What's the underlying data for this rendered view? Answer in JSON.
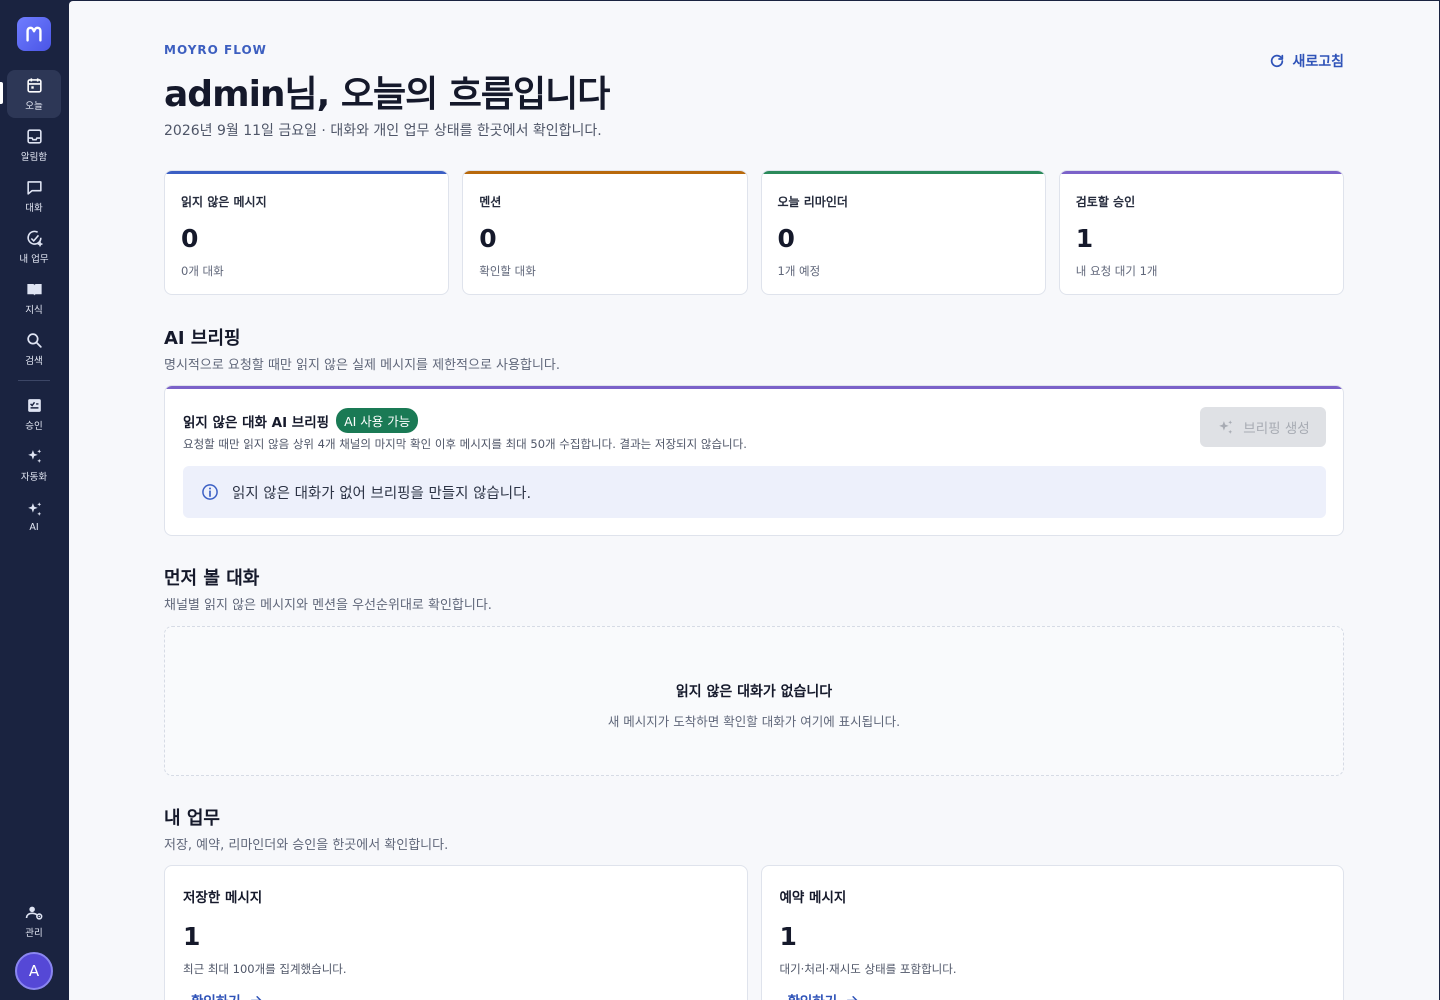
{
  "sidebar": {
    "items": [
      {
        "label": "오늘",
        "icon": "calendar-icon"
      },
      {
        "label": "알림함",
        "icon": "inbox-icon"
      },
      {
        "label": "대화",
        "icon": "chat-icon"
      },
      {
        "label": "내 업무",
        "icon": "check-plus-icon"
      },
      {
        "label": "지식",
        "icon": "book-icon"
      },
      {
        "label": "검색",
        "icon": "search-icon"
      },
      {
        "label": "승인",
        "icon": "approval-icon"
      },
      {
        "label": "자동화",
        "icon": "sparkle-icon"
      },
      {
        "label": "AI",
        "icon": "sparkle-icon"
      },
      {
        "label": "관리",
        "icon": "users-gear-icon"
      }
    ],
    "avatar_initial": "A"
  },
  "header": {
    "eyebrow": "MOYRO FLOW",
    "title": "admin님, 오늘의 흐름입니다",
    "subtitle": "2026년 9월 11일 금요일 · 대화와 개인 업무 상태를 한곳에서 확인합니다.",
    "refresh_label": "새로고침"
  },
  "stats": [
    {
      "label": "읽지 않은 메시지",
      "value": "0",
      "sub": "0개 대화"
    },
    {
      "label": "멘션",
      "value": "0",
      "sub": "확인할 대화"
    },
    {
      "label": "오늘 리마인더",
      "value": "0",
      "sub": "1개 예정"
    },
    {
      "label": "검토할 승인",
      "value": "1",
      "sub": "내 요청 대기 1개"
    }
  ],
  "ai_briefing": {
    "section_title": "AI 브리핑",
    "section_sub": "명시적으로 요청할 때만 읽지 않은 실제 메시지를 제한적으로 사용합니다.",
    "card_title": "읽지 않은 대화 AI 브리핑",
    "badge": "AI 사용 가능",
    "description": "요청할 때만 읽지 않음 상위 4개 채널의 마지막 확인 이후 메시지를 최대 50개 수집합니다. 결과는 저장되지 않습니다.",
    "button_label": "브리핑 생성",
    "info_text": "읽지 않은 대화가 없어 브리핑을 만들지 않습니다."
  },
  "priority": {
    "section_title": "먼저 볼 대화",
    "section_sub": "채널별 읽지 않은 메시지와 멘션을 우선순위대로 확인합니다.",
    "empty_title": "읽지 않은 대화가 없습니다",
    "empty_sub": "새 메시지가 도착하면 확인할 대화가 여기에 표시됩니다."
  },
  "my_tasks": {
    "section_title": "내 업무",
    "section_sub": "저장, 예약, 리마인더와 승인을 한곳에서 확인합니다.",
    "cards": [
      {
        "title": "저장한 메시지",
        "value": "1",
        "sub": "최근 최대 100개를 집계했습니다.",
        "link": "확인하기"
      },
      {
        "title": "예약 메시지",
        "value": "1",
        "sub": "대기·처리·재시도 상태를 포함합니다.",
        "link": "확인하기"
      }
    ]
  },
  "colors": {
    "sidebar_bg": "#1a2340",
    "accent": "#2f53b8",
    "unread": "#3b5fc4",
    "mention": "#b8690c",
    "reminder": "#2b8a5b",
    "approval": "#7b62c9",
    "badge": "#1a7a55"
  }
}
